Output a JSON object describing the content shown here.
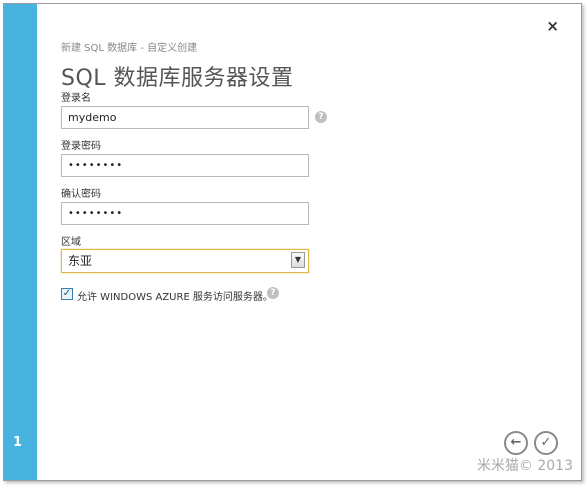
{
  "dialog": {
    "breadcrumb": "新建 SQL 数据库 - 自定义创建",
    "title": "SQL 数据库服务器设置",
    "step_number": "1",
    "close_glyph": "×"
  },
  "form": {
    "login_name": {
      "label": "登录名",
      "value": "mydemo"
    },
    "login_password": {
      "label": "登录密码",
      "value": "••••••••"
    },
    "confirm_password": {
      "label": "确认密码",
      "value": "••••••••"
    },
    "region": {
      "label": "区域",
      "selected": "东亚"
    },
    "allow_azure": {
      "label": "允许 WINDOWS AZURE 服务访问服务器。",
      "checked": true
    }
  },
  "help_glyph": "?",
  "nav": {
    "back_glyph": "←",
    "finish_glyph": "✓"
  },
  "watermark": "米米猫© 2013",
  "colors": {
    "accent": "#49b3e0",
    "select_border": "#e0b84a"
  }
}
